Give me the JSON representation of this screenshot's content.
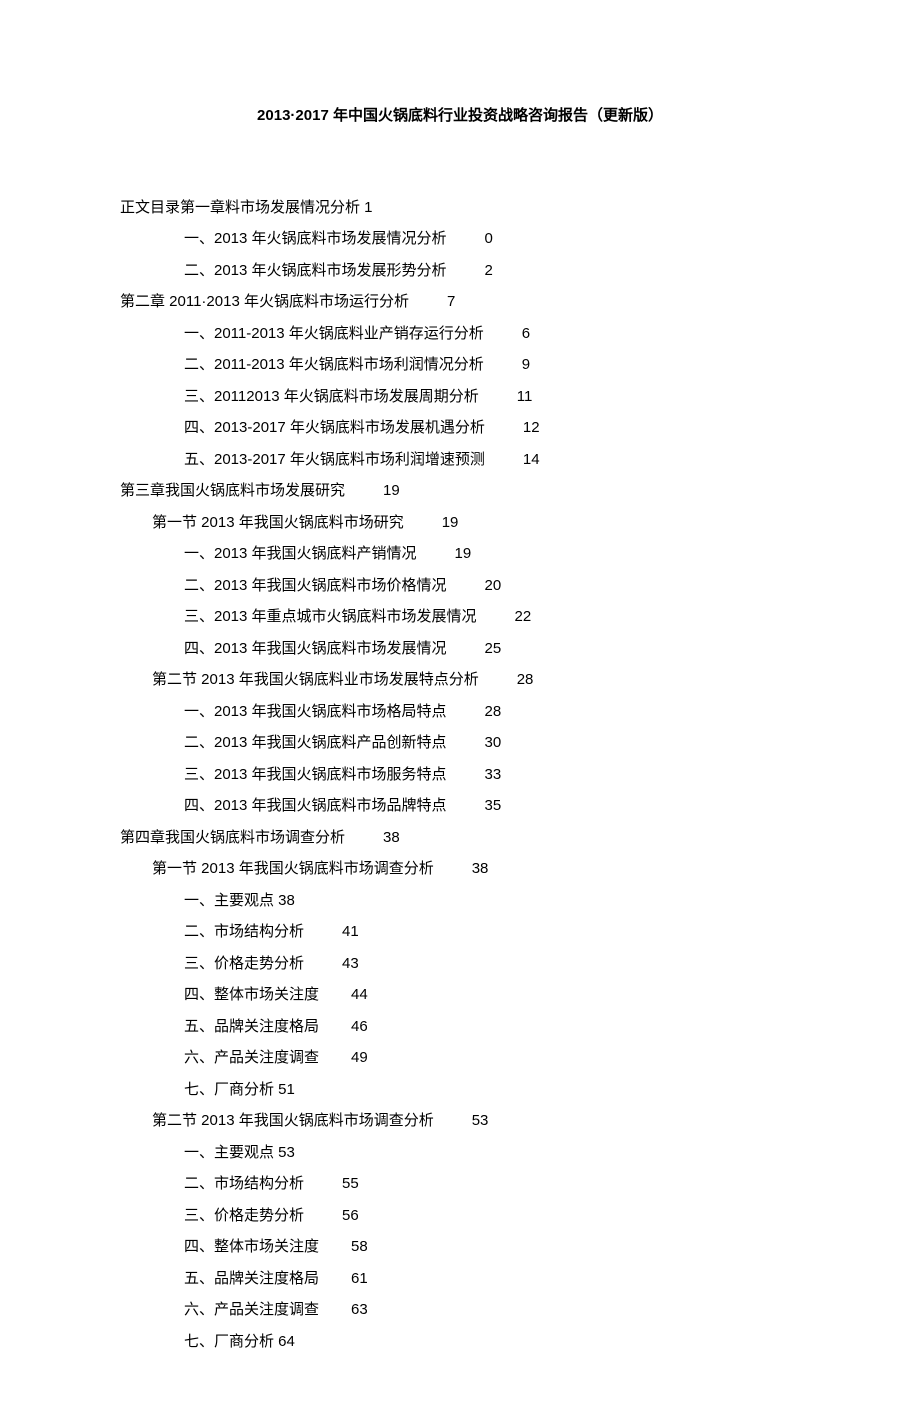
{
  "title": "2013·2017 年中国火锅底料行业投资战略咨询报告（更新版）",
  "lines": [
    {
      "indent": 0,
      "text": "正文目录第一章料市场发展情况分析 1",
      "page": ""
    },
    {
      "indent": 2,
      "text": "一、2013 年火锅底料市场发展情况分析",
      "page": "0"
    },
    {
      "indent": 2,
      "text": "二、2013 年火锅底料市场发展形势分析",
      "page": "2"
    },
    {
      "indent": 0,
      "text": "第二章 2011·2013 年火锅底料市场运行分析",
      "page": "7"
    },
    {
      "indent": 2,
      "text": "一、2011-2013 年火锅底料业产销存运行分析",
      "page": "6"
    },
    {
      "indent": 2,
      "text": "二、2011-2013 年火锅底料市场利润情况分析",
      "page": "9"
    },
    {
      "indent": 2,
      "text": "三、20112013 年火锅底料市场发展周期分析",
      "page": "11"
    },
    {
      "indent": 2,
      "text": "四、2013-2017 年火锅底料市场发展机遇分析",
      "page": "12"
    },
    {
      "indent": 2,
      "text": "五、2013-2017 年火锅底料市场利润增速预测",
      "page": "14"
    },
    {
      "indent": 0,
      "text": "第三章我国火锅底料市场发展研究",
      "page": "19"
    },
    {
      "indent": 1,
      "text": "第一节 2013 年我国火锅底料市场研究",
      "page": "19"
    },
    {
      "indent": 2,
      "text": "一、2013 年我国火锅底料产销情况",
      "page": "19"
    },
    {
      "indent": 2,
      "text": "二、2013 年我国火锅底料市场价格情况",
      "page": "20"
    },
    {
      "indent": 2,
      "text": "三、2013 年重点城市火锅底料市场发展情况",
      "page": "22"
    },
    {
      "indent": 2,
      "text": "四、2013 年我国火锅底料市场发展情况",
      "page": "25"
    },
    {
      "indent": 1,
      "text": "第二节 2013 年我国火锅底料业市场发展特点分析",
      "page": "28"
    },
    {
      "indent": 2,
      "text": "一、2013 年我国火锅底料市场格局特点",
      "page": "28"
    },
    {
      "indent": 2,
      "text": "二、2013 年我国火锅底料产品创新特点",
      "page": "30"
    },
    {
      "indent": 2,
      "text": "三、2013 年我国火锅底料市场服务特点",
      "page": "33"
    },
    {
      "indent": 2,
      "text": "四、2013 年我国火锅底料市场品牌特点",
      "page": "35"
    },
    {
      "indent": 0,
      "text": "第四章我国火锅底料市场调查分析",
      "page": "38"
    },
    {
      "indent": 1,
      "text": "第一节 2013 年我国火锅底料市场调查分析",
      "page": "38"
    },
    {
      "indent": 2,
      "text": "一、主要观点 38",
      "page": ""
    },
    {
      "indent": 2,
      "text": "二、市场结构分析",
      "page": "41"
    },
    {
      "indent": 2,
      "text": "三、价格走势分析",
      "page": "43"
    },
    {
      "indent": 2,
      "text": "四、整体市场关注度",
      "page": "44",
      "gap": "s"
    },
    {
      "indent": 2,
      "text": "五、品牌关注度格局",
      "page": "46",
      "gap": "s"
    },
    {
      "indent": 2,
      "text": "六、产品关注度调查",
      "page": "49",
      "gap": "s"
    },
    {
      "indent": 2,
      "text": "七、厂商分析 51",
      "page": ""
    },
    {
      "indent": 1,
      "text": "第二节 2013 年我国火锅底料市场调查分析",
      "page": "53"
    },
    {
      "indent": 2,
      "text": "一、主要观点 53",
      "page": ""
    },
    {
      "indent": 2,
      "text": "二、市场结构分析",
      "page": "55"
    },
    {
      "indent": 2,
      "text": "三、价格走势分析",
      "page": "56"
    },
    {
      "indent": 2,
      "text": "四、整体市场关注度",
      "page": "58",
      "gap": "s"
    },
    {
      "indent": 2,
      "text": "五、品牌关注度格局",
      "page": "61",
      "gap": "s"
    },
    {
      "indent": 2,
      "text": "六、产品关注度调查",
      "page": "63",
      "gap": "s"
    },
    {
      "indent": 2,
      "text": "七、厂商分析 64",
      "page": ""
    }
  ]
}
